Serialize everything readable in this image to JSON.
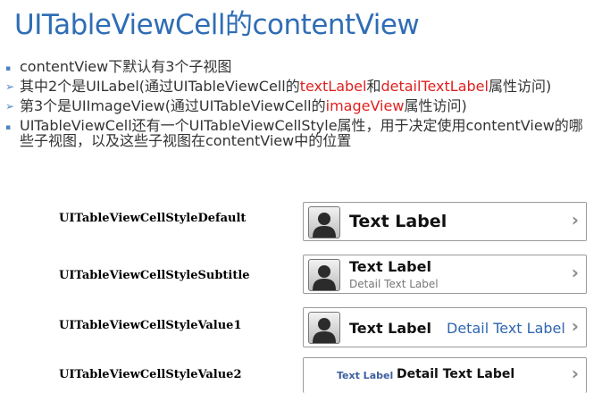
{
  "title": "UITableViewCell的contentView",
  "bullets": [
    {
      "marker": "▪",
      "parts": [
        {
          "text": "contentView下默认有3个子视图",
          "red": false
        }
      ]
    },
    {
      "marker": "➢",
      "parts": [
        {
          "text": "其中2个是UILabel(通过UITableViewCell的",
          "red": false
        },
        {
          "text": "textLabel",
          "red": true
        },
        {
          "text": "和",
          "red": false
        },
        {
          "text": "detailTextLabel",
          "red": true
        },
        {
          "text": "属性访问)",
          "red": false
        }
      ]
    },
    {
      "marker": "➢",
      "parts": [
        {
          "text": "第3个是UIImageView(通过UITableViewCell的",
          "red": false
        },
        {
          "text": "imageView",
          "red": true
        },
        {
          "text": "属性访问)",
          "red": false
        }
      ]
    },
    {
      "marker": "▪",
      "parts": [
        {
          "text": "UITableViewCell还有一个UITableViewCellStyle属性，用于决定使用contentView的哪些子视图，以及这些子视图在contentView中的位置",
          "red": false
        }
      ]
    }
  ],
  "styles": {
    "default": {
      "name": "UITableViewCellStyleDefault",
      "text_label": "Text Label",
      "chevron": "›"
    },
    "subtitle": {
      "name": "UITableViewCellStyleSubtitle",
      "text_label": "Text Label",
      "detail_label": "Detail Text Label",
      "chevron": "›"
    },
    "value1": {
      "name": "UITableViewCellStyleValue1",
      "text_label": "Text Label",
      "detail_label": "Detail Text Label",
      "chevron": "›"
    },
    "value2": {
      "name": "UITableViewCellStyleValue2",
      "text_label": "Text Label",
      "detail_label": "Detail Text Label",
      "chevron": "›"
    }
  },
  "colors": {
    "title": "#2f6db5",
    "highlight": "#e02020",
    "value1_detail": "#2f66b0",
    "value2_label": "#3d5f9e"
  },
  "icons": {
    "cell_image": "person-silhouette-icon",
    "accessory": "chevron-right-icon"
  }
}
